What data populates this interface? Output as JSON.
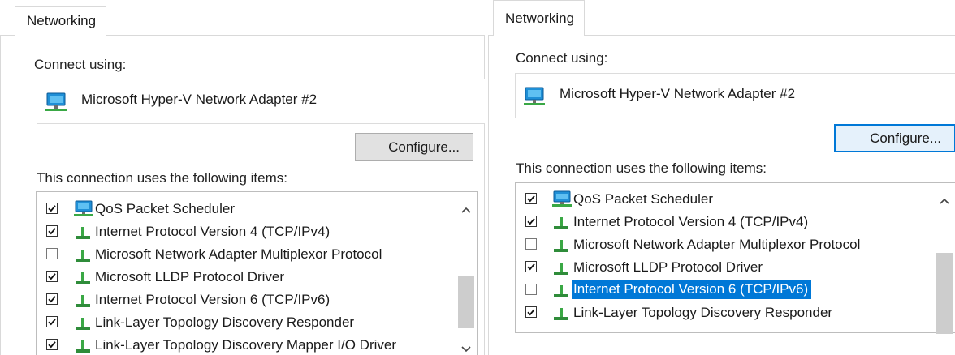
{
  "colors": {
    "selection": "#0078d7",
    "button_face": "#e1e1e1",
    "button_focus_border": "#0078d7",
    "scroll_thumb": "#cdcdcd"
  },
  "panels": [
    {
      "tab": "Networking",
      "connect_using_label": "Connect using:",
      "adapter": {
        "name": "Microsoft Hyper-V Network Adapter #2",
        "icon": "network-adapter-icon"
      },
      "configure_button": {
        "label": "Configure...",
        "focused": false
      },
      "items_label": "This connection uses the following items:",
      "items": [
        {
          "label": "QoS Packet Scheduler",
          "checked": true,
          "icon": "qos-scheduler-icon",
          "selected": false
        },
        {
          "label": "Internet Protocol Version 4 (TCP/IPv4)",
          "checked": true,
          "icon": "protocol-icon",
          "selected": false
        },
        {
          "label": "Microsoft Network Adapter Multiplexor Protocol",
          "checked": false,
          "icon": "protocol-icon",
          "selected": false
        },
        {
          "label": "Microsoft LLDP Protocol Driver",
          "checked": true,
          "icon": "protocol-icon",
          "selected": false
        },
        {
          "label": "Internet Protocol Version 6 (TCP/IPv6)",
          "checked": true,
          "icon": "protocol-icon",
          "selected": false
        },
        {
          "label": "Link-Layer Topology Discovery Responder",
          "checked": true,
          "icon": "protocol-icon",
          "selected": false
        },
        {
          "label": "Link-Layer Topology Discovery Mapper I/O Driver",
          "checked": true,
          "icon": "protocol-icon",
          "selected": false
        }
      ],
      "scrollbar": {
        "up_icon": "chevron-up-icon",
        "down_icon": "chevron-down-icon"
      }
    },
    {
      "tab": "Networking",
      "connect_using_label": "Connect using:",
      "adapter": {
        "name": "Microsoft Hyper-V Network Adapter #2",
        "icon": "network-adapter-icon"
      },
      "configure_button": {
        "label": "Configure...",
        "focused": true
      },
      "items_label": "This connection uses the following items:",
      "items": [
        {
          "label": "QoS Packet Scheduler",
          "checked": true,
          "icon": "qos-scheduler-icon",
          "selected": false
        },
        {
          "label": "Internet Protocol Version 4 (TCP/IPv4)",
          "checked": true,
          "icon": "protocol-icon",
          "selected": false
        },
        {
          "label": "Microsoft Network Adapter Multiplexor Protocol",
          "checked": false,
          "icon": "protocol-icon",
          "selected": false
        },
        {
          "label": "Microsoft LLDP Protocol Driver",
          "checked": true,
          "icon": "protocol-icon",
          "selected": false
        },
        {
          "label": "Internet Protocol Version 6 (TCP/IPv6)",
          "checked": false,
          "icon": "protocol-icon",
          "selected": true
        },
        {
          "label": "Link-Layer Topology Discovery Responder",
          "checked": true,
          "icon": "protocol-icon",
          "selected": false
        }
      ],
      "scrollbar": {
        "up_icon": "chevron-up-icon"
      }
    }
  ]
}
